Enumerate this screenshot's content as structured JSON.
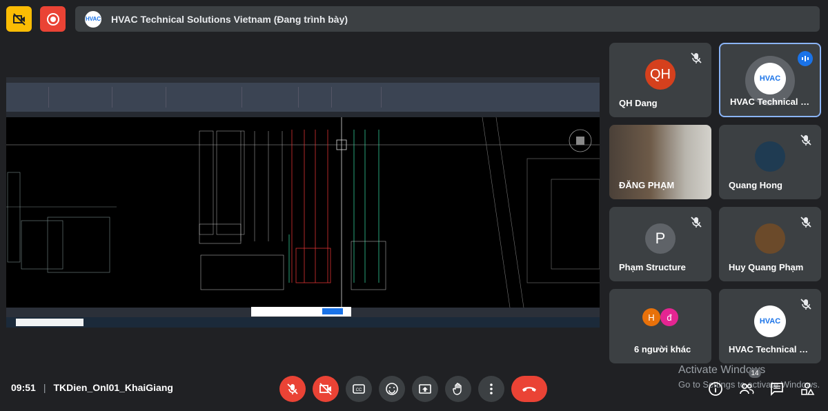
{
  "top_bar": {
    "presentation_title": "HVAC Technical Solutions Vietnam (Đang trình bày)"
  },
  "participants": [
    {
      "name": "QH Dang",
      "avatar_text": "QH",
      "muted": true
    },
    {
      "name": "HVAC Technical S...",
      "avatar_text": "HVAC",
      "speaking": true
    },
    {
      "name": "ĐĂNG PHẠM",
      "video": true
    },
    {
      "name": "Quang Hong",
      "muted": true
    },
    {
      "name": "Phạm Structure",
      "avatar_text": "P",
      "muted": true
    },
    {
      "name": "Huy Quang Phạm",
      "muted": true
    },
    {
      "name": "6 người khác",
      "avatar_text_1": "H",
      "avatar_text_2": "đ"
    },
    {
      "name": "HVAC Technical S...",
      "avatar_text": "HVAC",
      "muted": true
    }
  ],
  "bottom_bar": {
    "time": "09:51",
    "separator": "|",
    "meeting_name": "TKDien_Onl01_KhaiGiang",
    "people_count": "14"
  },
  "watermark": {
    "line1": "Activate Windows",
    "line2": "Go to Settings to activate Windows."
  },
  "colors": {
    "background": "#202124",
    "tile": "#3c4043",
    "red": "#ea4335",
    "yellow": "#fbbc04",
    "accent_blue": "#1a73e8"
  }
}
